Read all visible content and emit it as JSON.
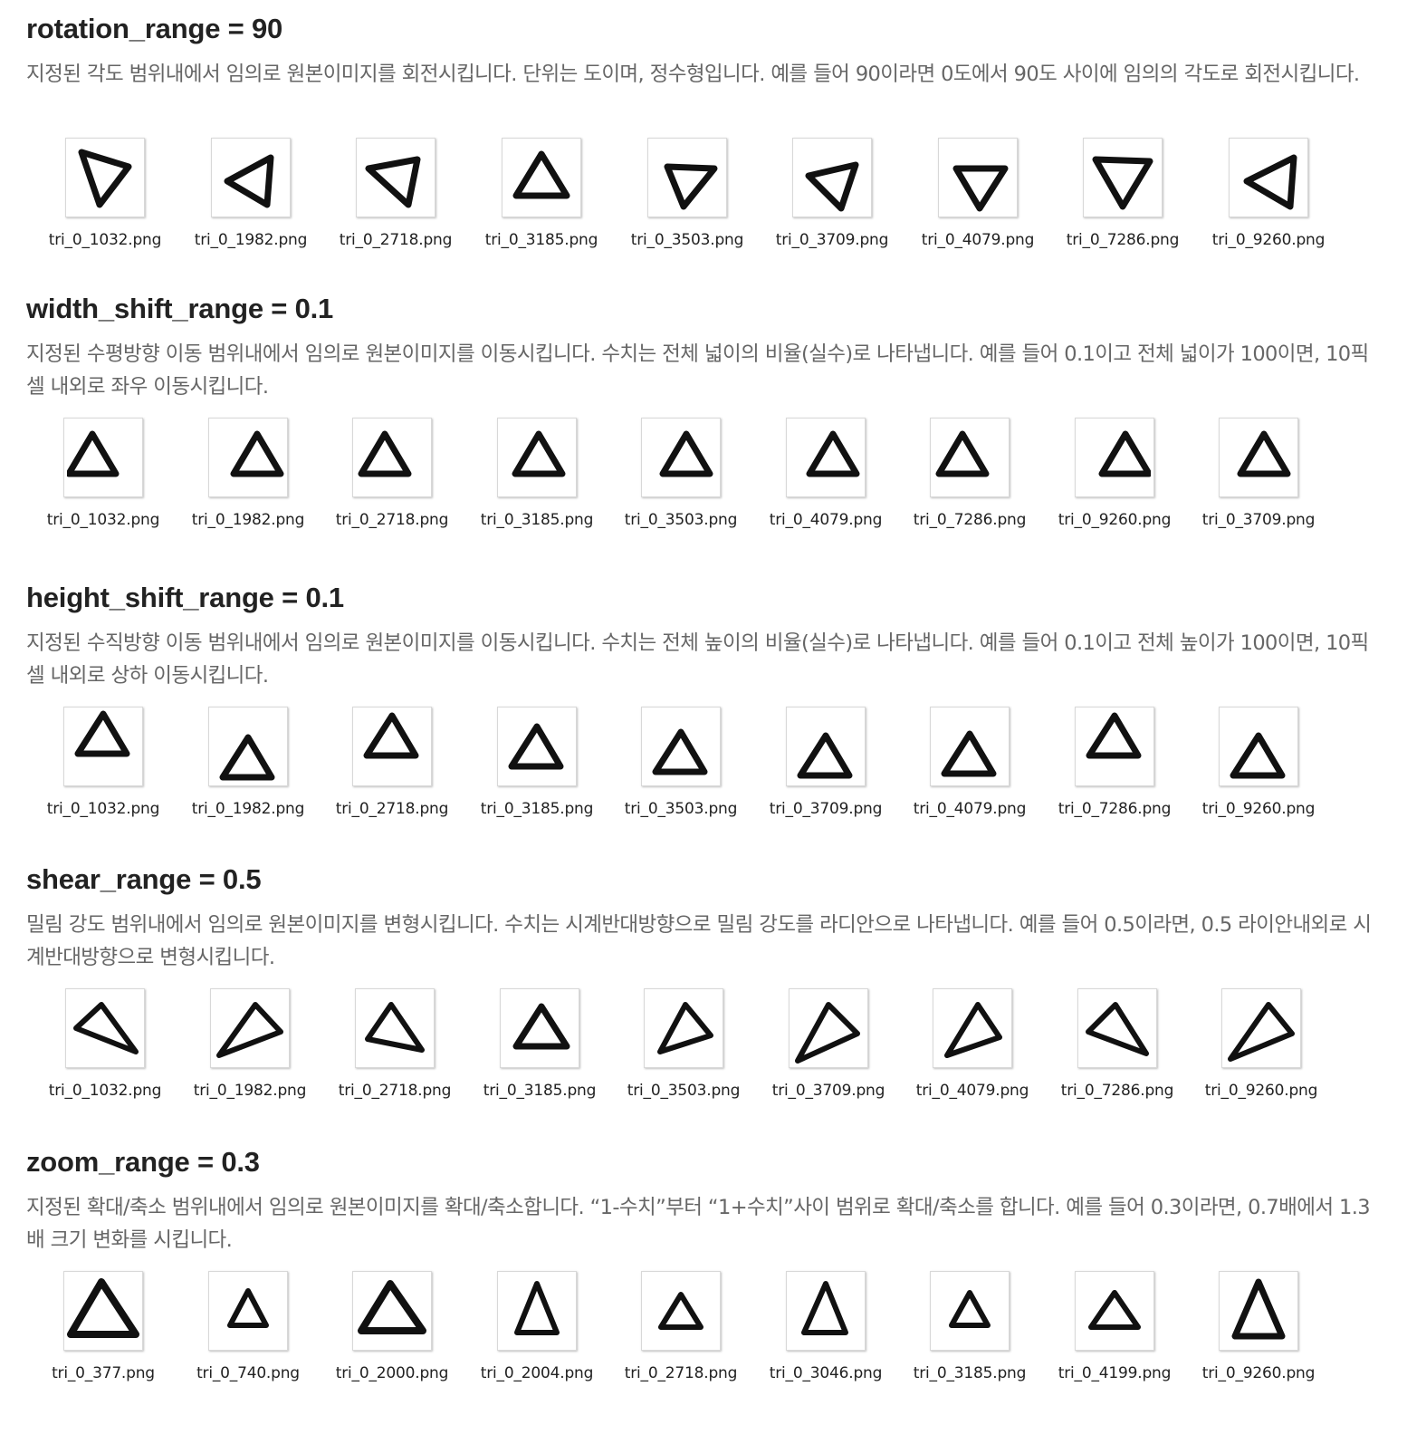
{
  "sections": [
    {
      "title": "rotation_range = 90",
      "description": "지정된 각도 범위내에서 임의로 원본이미지를 회전시킵니다. 단위는 도이며, 정수형입니다. 예를 들어 90이라면 0도에서 90도 사이에 임의의 각도로 회전시킵니다.",
      "files": [
        "tri_0_1032.png",
        "tri_0_1982.png",
        "tri_0_2718.png",
        "tri_0_3185.png",
        "tri_0_3503.png",
        "tri_0_3709.png",
        "tri_0_4079.png",
        "tri_0_7286.png",
        "tri_0_9260.png"
      ]
    },
    {
      "title": "width_shift_range = 0.1",
      "description": "지정된 수평방향 이동 범위내에서 임의로 원본이미지를 이동시킵니다. 수치는 전체 넓이의 비율(실수)로 나타냅니다. 예를 들어 0.1이고 전체 넓이가 100이면, 10픽셀 내외로 좌우 이동시킵니다.",
      "files": [
        "tri_0_1032.png",
        "tri_0_1982.png",
        "tri_0_2718.png",
        "tri_0_3185.png",
        "tri_0_3503.png",
        "tri_0_4079.png",
        "tri_0_7286.png",
        "tri_0_9260.png",
        "tri_0_3709.png"
      ]
    },
    {
      "title": "height_shift_range = 0.1",
      "description": "지정된 수직방향 이동 범위내에서 임의로 원본이미지를 이동시킵니다. 수치는 전체 높이의 비율(실수)로 나타냅니다. 예를 들어 0.1이고 전체 높이가 100이면, 10픽셀 내외로 상하 이동시킵니다.",
      "files": [
        "tri_0_1032.png",
        "tri_0_1982.png",
        "tri_0_2718.png",
        "tri_0_3185.png",
        "tri_0_3503.png",
        "tri_0_3709.png",
        "tri_0_4079.png",
        "tri_0_7286.png",
        "tri_0_9260.png"
      ]
    },
    {
      "title": "shear_range = 0.5",
      "description": "밀림 강도 범위내에서 임의로 원본이미지를 변형시킵니다. 수치는 시계반대방향으로 밀림 강도를 라디안으로 나타냅니다. 예를 들어 0.5이라면, 0.5 라이안내외로 시계반대방향으로 변형시킵니다.",
      "files": [
        "tri_0_1032.png",
        "tri_0_1982.png",
        "tri_0_2718.png",
        "tri_0_3185.png",
        "tri_0_3503.png",
        "tri_0_3709.png",
        "tri_0_4079.png",
        "tri_0_7286.png",
        "tri_0_9260.png"
      ]
    },
    {
      "title": "zoom_range = 0.3",
      "description": "지정된 확대/축소 범위내에서 임의로 원본이미지를 확대/축소합니다. “1-수치”부터 “1+수치”사이 범위로 확대/축소를 합니다. 예를 들어 0.3이라면, 0.7배에서 1.3배 크기 변화를 시킵니다.",
      "files": [
        "tri_0_377.png",
        "tri_0_740.png",
        "tri_0_2000.png",
        "tri_0_2004.png",
        "tri_0_2718.png",
        "tri_0_3046.png",
        "tri_0_3185.png",
        "tri_0_4199.png",
        "tri_0_9260.png"
      ]
    }
  ]
}
